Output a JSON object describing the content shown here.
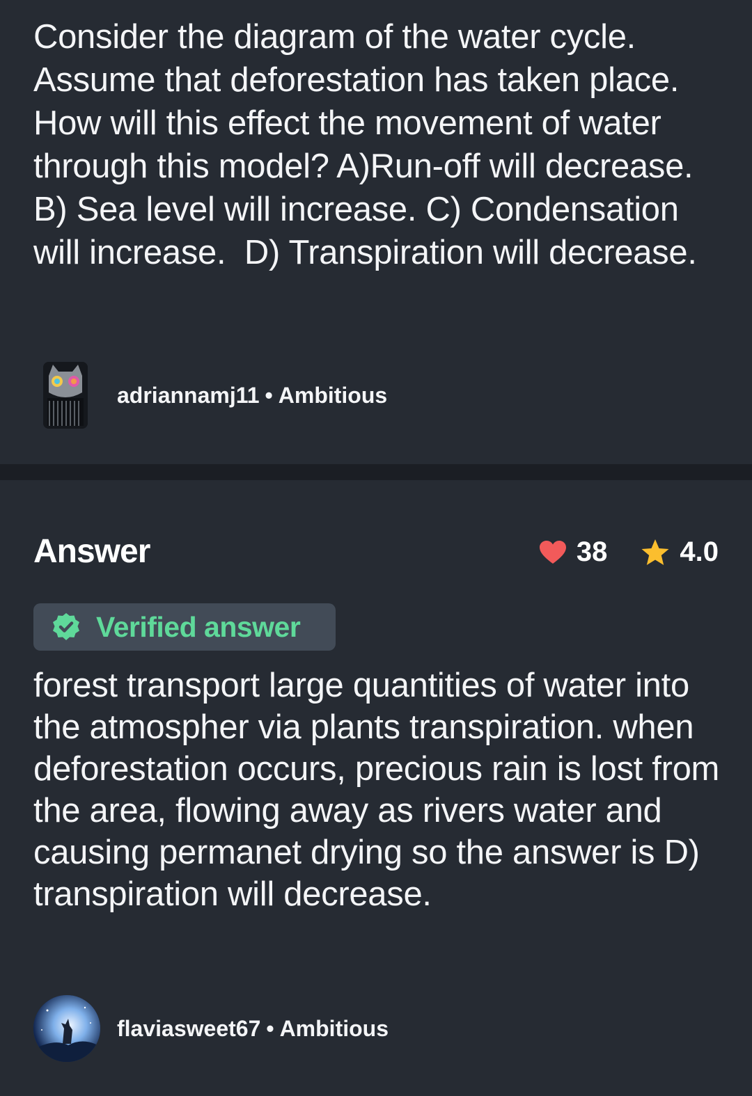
{
  "question": {
    "text": "Consider the diagram of the water cycle. Assume that deforestation has taken place. How will this effect the movement of water through this model? A)Run-off will decrease.  B) Sea level will increase. C) Condensation will increase.  D) Transpiration will decrease.",
    "author": "adriannamj11",
    "rank": "Ambitious"
  },
  "answer": {
    "title": "Answer",
    "likes": "38",
    "rating": "4.0",
    "verified_label": "Verified answer",
    "text": "forest transport large quantities of water into the atmospher via plants transpiration. when deforestation occurs, precious rain is lost from the area, flowing away as rivers water and causing permanet drying so the answer is D) transpiration will decrease.",
    "author": "flaviasweet67",
    "rank": "Ambitious"
  },
  "colors": {
    "background": "#262b33",
    "divider": "#1b1e24",
    "heart": "#f25a5a",
    "star": "#fbbe2e",
    "verified": "#5fd99a",
    "verified_bg": "#424b57"
  },
  "icons": {
    "like": "heart-icon",
    "rating": "star-icon",
    "verified": "verified-badge-icon"
  }
}
